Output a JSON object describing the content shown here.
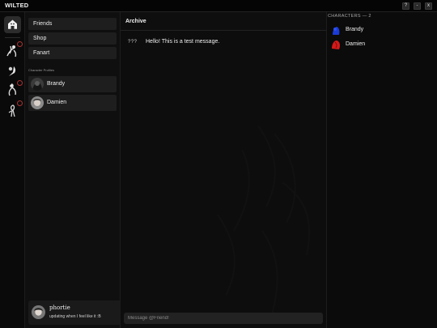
{
  "app": {
    "title": "WILTED"
  },
  "window_controls": {
    "help": "?",
    "minimize": "-",
    "close": "x"
  },
  "sidebar": {
    "nav": [
      "Friends",
      "Shop",
      "Fanart"
    ],
    "section_label": "Character Profiles",
    "profiles": [
      {
        "name": "Brandy"
      },
      {
        "name": "Damien"
      }
    ]
  },
  "user": {
    "name": "phortie",
    "status": "updating when I feel like it :B"
  },
  "channel": {
    "title": "Archive",
    "messages": [
      {
        "author": "???",
        "text": "Hello! This is a test message."
      }
    ],
    "composer_placeholder": "Message @Friend!"
  },
  "members": {
    "header": "CHARACTERS — 2",
    "list": [
      {
        "name": "Brandy",
        "color": "#1b3bd6"
      },
      {
        "name": "Damien",
        "color": "#d41a1a"
      }
    ]
  },
  "colors": {
    "accent_blue": "#1b3bd6",
    "accent_red": "#d41a1a",
    "badge_red": "#aa3333"
  },
  "icons": [
    "home-icon",
    "gear-icon",
    "server-art-icon"
  ]
}
